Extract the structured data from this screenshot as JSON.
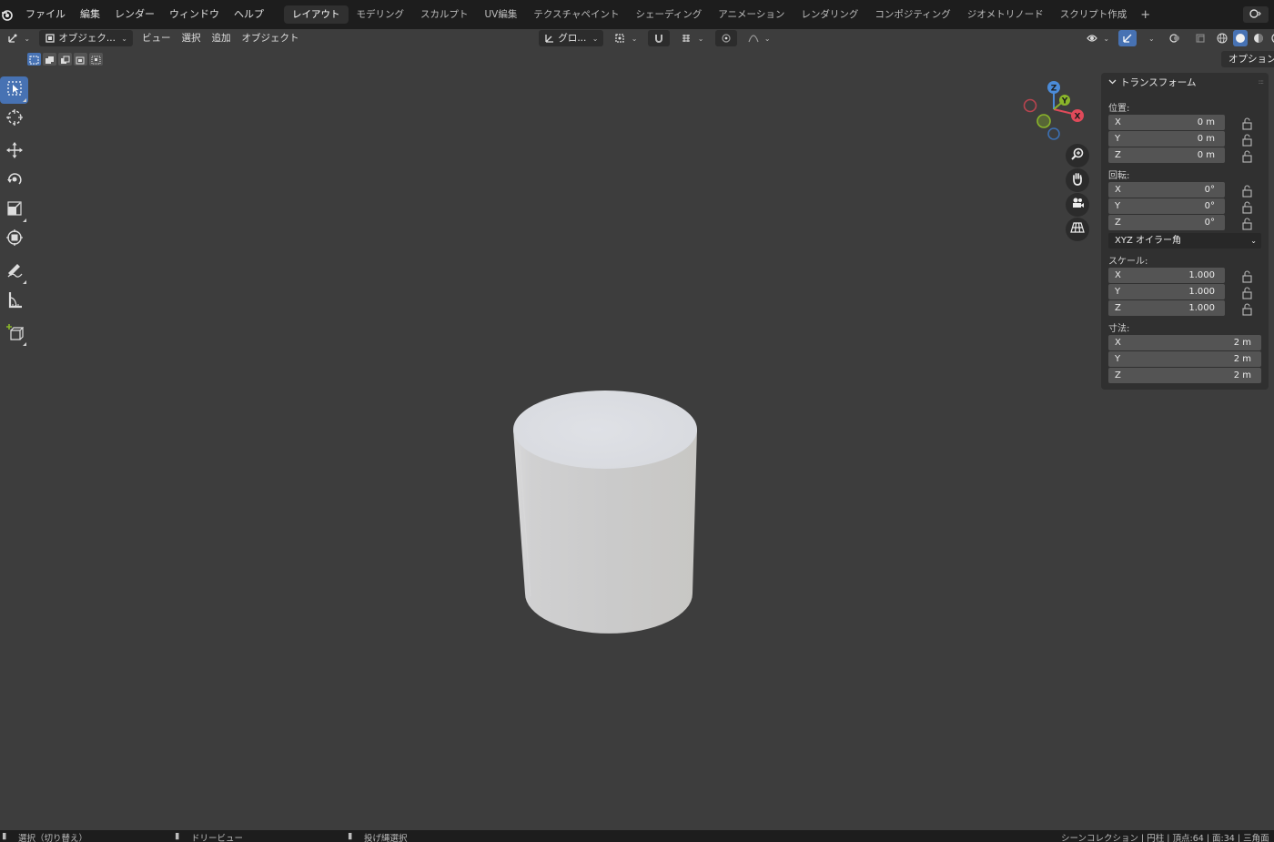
{
  "topbar": {
    "menus": [
      "ファイル",
      "編集",
      "レンダー",
      "ウィンドウ",
      "ヘルプ"
    ],
    "workspace_tabs": [
      "レイアウト",
      "モデリング",
      "スカルプト",
      "UV編集",
      "テクスチャペイント",
      "シェーディング",
      "アニメーション",
      "レンダリング",
      "コンポジティング",
      "ジオメトリノード",
      "スクリプト作成"
    ],
    "active_tab": "レイアウト",
    "add_tab": "+"
  },
  "viewport_header": {
    "mode": "オブジェク...",
    "menus": [
      "ビュー",
      "選択",
      "追加",
      "オブジェクト"
    ],
    "transform_orientation": "グロ..."
  },
  "options_label": "オプション",
  "npanel": {
    "title": "トランスフォーム",
    "location_label": "位置:",
    "location": [
      {
        "axis": "X",
        "value": "0 m"
      },
      {
        "axis": "Y",
        "value": "0 m"
      },
      {
        "axis": "Z",
        "value": "0 m"
      }
    ],
    "rotation_label": "回転:",
    "rotation": [
      {
        "axis": "X",
        "value": "0°"
      },
      {
        "axis": "Y",
        "value": "0°"
      },
      {
        "axis": "Z",
        "value": "0°"
      }
    ],
    "rotation_mode": "XYZ オイラー角",
    "scale_label": "スケール:",
    "scale": [
      {
        "axis": "X",
        "value": "1.000"
      },
      {
        "axis": "Y",
        "value": "1.000"
      },
      {
        "axis": "Z",
        "value": "1.000"
      }
    ],
    "dimensions_label": "寸法:",
    "dimensions": [
      {
        "axis": "X",
        "value": "2 m"
      },
      {
        "axis": "Y",
        "value": "2 m"
      },
      {
        "axis": "Z",
        "value": "2 m"
      }
    ]
  },
  "gizmo": {
    "x": "X",
    "y": "Y",
    "z": "Z"
  },
  "statusbar": {
    "left": "選択（切り替え）",
    "middle": "ドリービュー",
    "right_hint": "投げ縄選択",
    "stats": "シーンコレクション | 円柱 | 頂点:64 | 面:34 | 三角面"
  },
  "colors": {
    "accent": "#4772b3",
    "x_axis": "#e04a5a",
    "y_axis": "#8ab52a",
    "z_axis": "#4b8bd8",
    "viewport_bg": "#3d3d3d"
  }
}
